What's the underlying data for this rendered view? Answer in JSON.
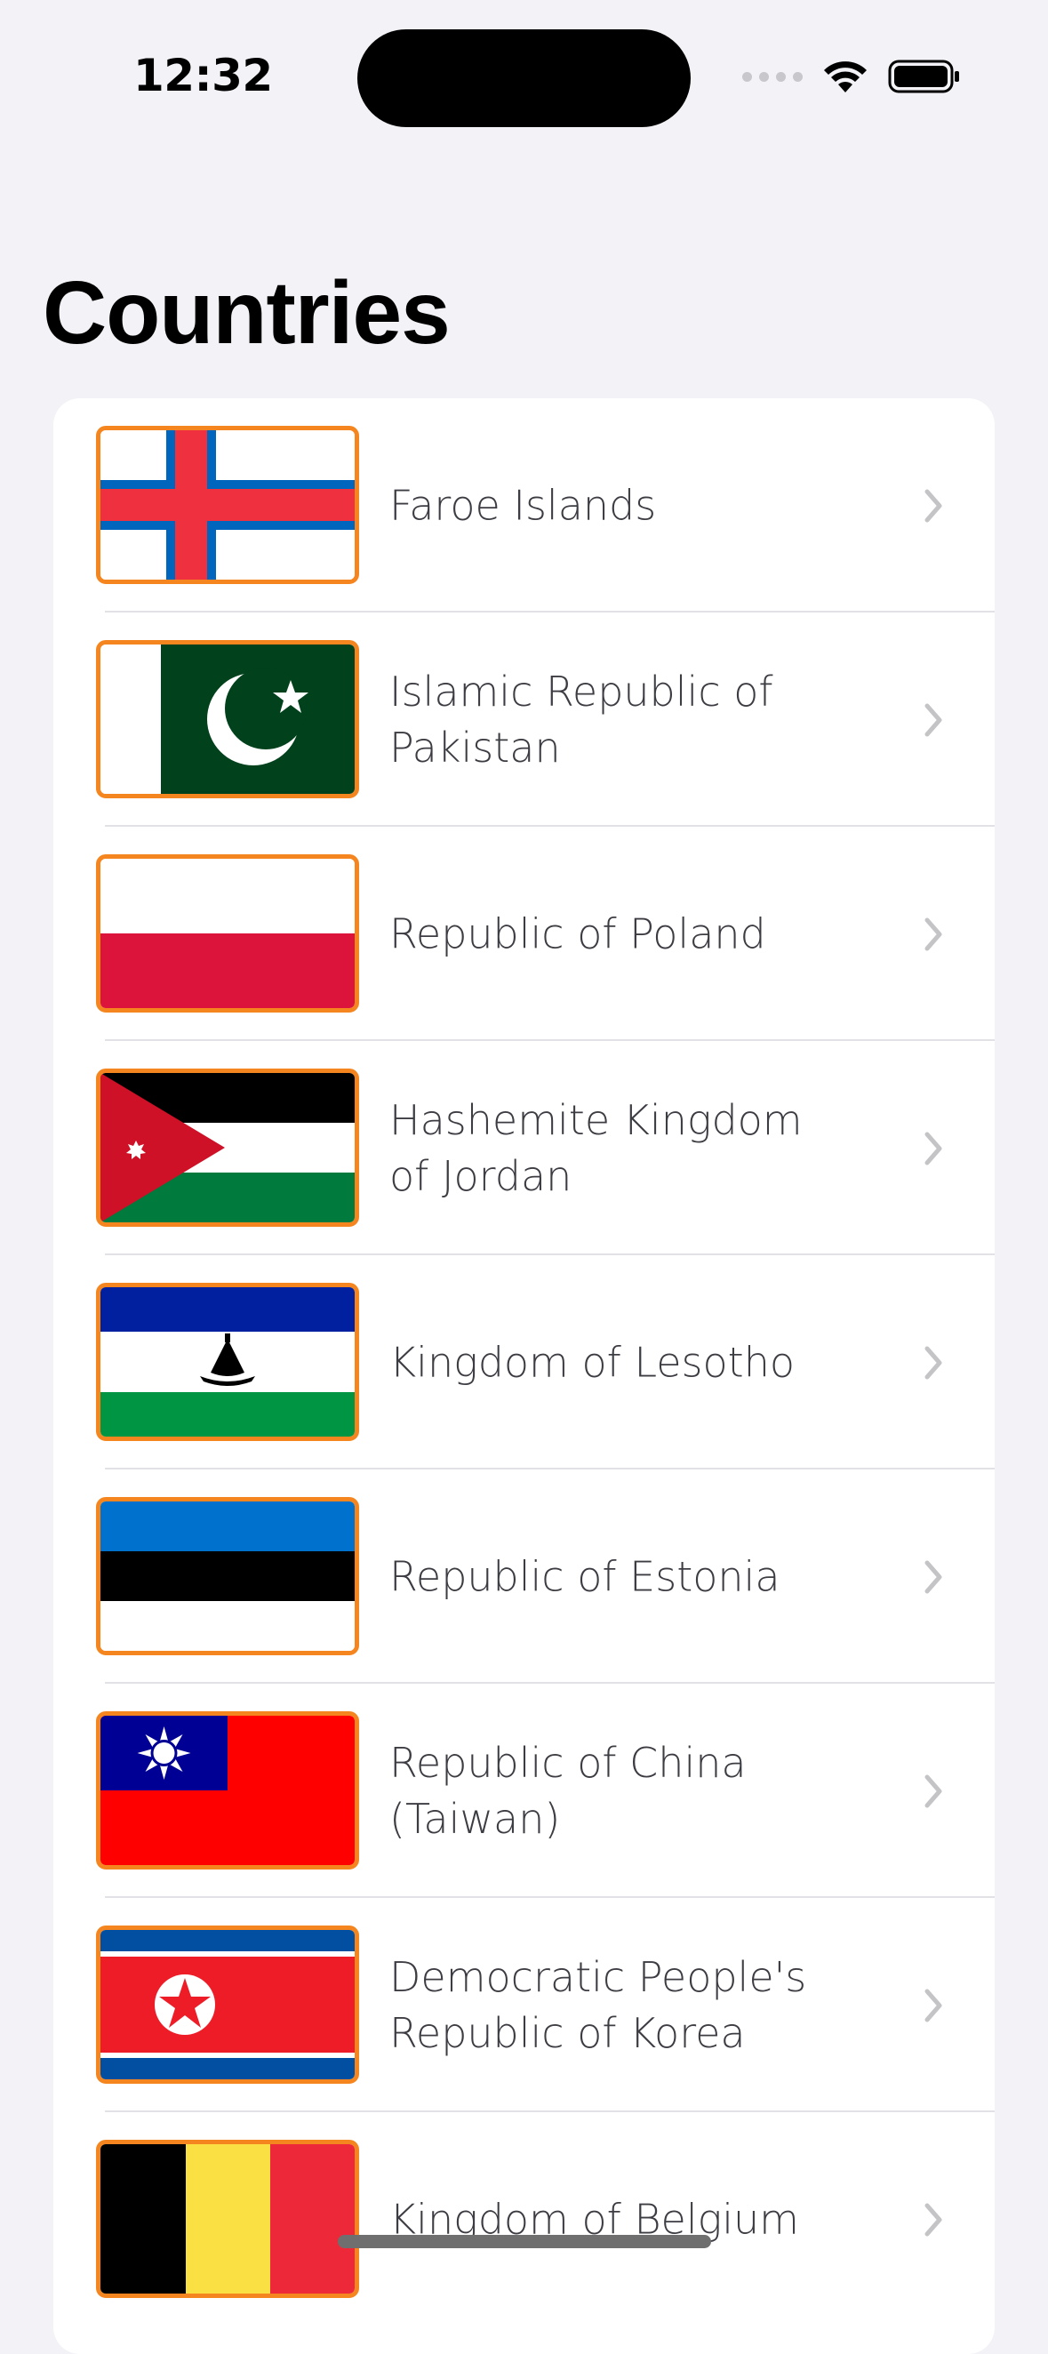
{
  "status_bar": {
    "time": "12:32"
  },
  "page": {
    "title": "Countries"
  },
  "countries": [
    {
      "name": "Faroe Islands",
      "flag": "faroe-islands-flag-icon"
    },
    {
      "name": "Islamic Republic of Pakistan",
      "flag": "pakistan-flag-icon"
    },
    {
      "name": "Republic of Poland",
      "flag": "poland-flag-icon"
    },
    {
      "name": "Hashemite Kingdom of Jordan",
      "flag": "jordan-flag-icon"
    },
    {
      "name": "Kingdom of Lesotho",
      "flag": "lesotho-flag-icon"
    },
    {
      "name": "Republic of Estonia",
      "flag": "estonia-flag-icon"
    },
    {
      "name": "Republic of China (Taiwan)",
      "flag": "taiwan-flag-icon"
    },
    {
      "name": "Democratic People's Republic of Korea",
      "flag": "north-korea-flag-icon"
    },
    {
      "name": "Kingdom of Belgium",
      "flag": "belgium-flag-icon"
    }
  ],
  "colors": {
    "background": "#f2f2f7",
    "card": "#ffffff",
    "flag_border": "#f5861f",
    "chevron": "#c4c4c7",
    "label": "#3c3c43"
  }
}
